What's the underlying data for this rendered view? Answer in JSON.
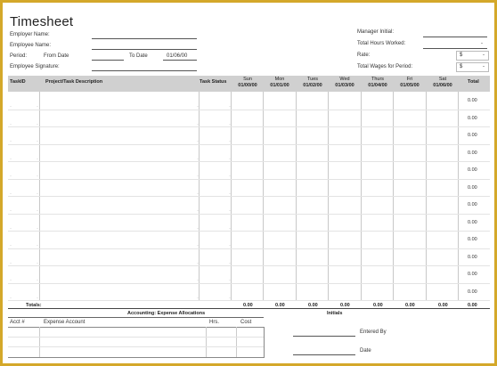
{
  "title": "Timesheet",
  "header_left": {
    "employer_label": "Employer Name:",
    "employee_label": "Employee Name:",
    "period_label": "Period:",
    "from_label": "From Date",
    "to_label": "To Date",
    "to_value": "01/06/00",
    "signature_label": "Employee Signature:"
  },
  "header_right": {
    "manager_label": "Manager Initial:",
    "hours_label": "Total Hours Worked:",
    "hours_value": "-",
    "rate_label": "Rate:",
    "rate_currency": "$",
    "rate_value": "-",
    "wages_label": "Total Wages for Period:",
    "wages_currency": "$",
    "wages_value": "-"
  },
  "table": {
    "col_taskid": "TaskID",
    "col_desc": "Project/Task Description",
    "col_status": "Task Status",
    "days": [
      {
        "day": "Sun",
        "date": "01/00/00"
      },
      {
        "day": "Mon",
        "date": "01/01/00"
      },
      {
        "day": "Tues",
        "date": "01/02/00"
      },
      {
        "day": "Wed",
        "date": "01/03/00"
      },
      {
        "day": "Thurs",
        "date": "01/04/00"
      },
      {
        "day": "Fri",
        "date": "01/05/00"
      },
      {
        "day": "Sat",
        "date": "01/06/00"
      }
    ],
    "col_total": "Total",
    "row_total": "0.00",
    "row_count": 12,
    "totals_label": "Totals:",
    "totals_values": [
      "0.00",
      "0.00",
      "0.00",
      "0.00",
      "0.00",
      "0.00",
      "0.00",
      "0.00"
    ]
  },
  "accounting": {
    "title": "Accounting: Expense Allocations",
    "acct_label": "Acct #",
    "expense_label": "Expense Account",
    "hrs_label": "Hrs.",
    "cost_label": "Cost"
  },
  "initials": {
    "title": "Initials",
    "entered_label": "Entered By",
    "date_label": "Date"
  }
}
